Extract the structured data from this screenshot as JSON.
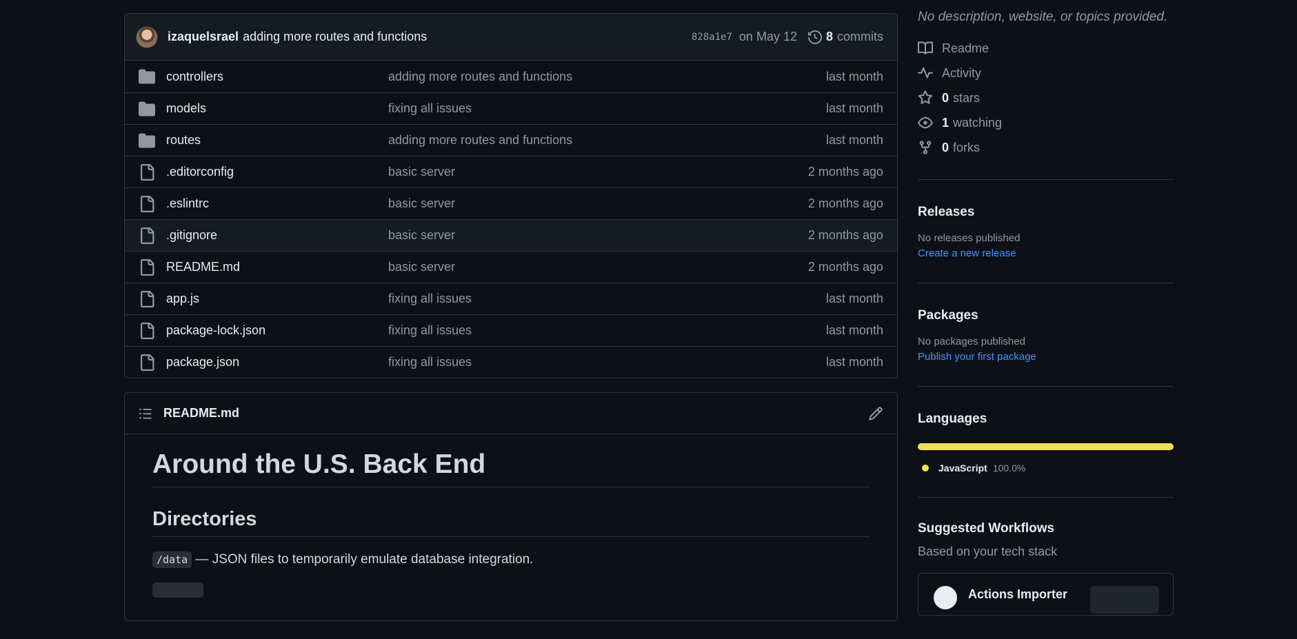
{
  "commit": {
    "author": "izaquelsrael",
    "message": "adding more routes and functions",
    "sha": "828a1e7",
    "date": "on May 12",
    "commit_count": "8",
    "commit_label": "commits"
  },
  "files": [
    {
      "name": "controllers",
      "type": "dir",
      "message": "adding more routes and functions",
      "age": "last month"
    },
    {
      "name": "models",
      "type": "dir",
      "message": "fixing all issues",
      "age": "last month"
    },
    {
      "name": "routes",
      "type": "dir",
      "message": "adding more routes and functions",
      "age": "last month"
    },
    {
      "name": ".editorconfig",
      "type": "file",
      "message": "basic server",
      "age": "2 months ago"
    },
    {
      "name": ".eslintrc",
      "type": "file",
      "message": "basic server",
      "age": "2 months ago"
    },
    {
      "name": ".gitignore",
      "type": "file",
      "message": "basic server",
      "age": "2 months ago"
    },
    {
      "name": "README.md",
      "type": "file",
      "message": "basic server",
      "age": "2 months ago"
    },
    {
      "name": "app.js",
      "type": "file",
      "message": "fixing all issues",
      "age": "last month"
    },
    {
      "name": "package-lock.json",
      "type": "file",
      "message": "fixing all issues",
      "age": "last month"
    },
    {
      "name": "package.json",
      "type": "file",
      "message": "fixing all issues",
      "age": "last month"
    }
  ],
  "readme": {
    "filename": "README.md",
    "h1": "Around the U.S. Back End",
    "h2": "Directories",
    "p1_code": "/data",
    "p1_text": " — JSON files to temporarily emulate database integration."
  },
  "about": {
    "description": "No description, website, or topics provided.",
    "readme": "Readme",
    "activity": "Activity",
    "stars_count": "0",
    "stars_label": "stars",
    "watching_count": "1",
    "watching_label": "watching",
    "forks_count": "0",
    "forks_label": "forks"
  },
  "releases": {
    "title": "Releases",
    "none": "No releases published",
    "link": "Create a new release"
  },
  "packages": {
    "title": "Packages",
    "none": "No packages published",
    "link": "Publish your first package"
  },
  "languages": {
    "title": "Languages",
    "items": [
      {
        "name": "JavaScript",
        "percent": "100.0%",
        "color": "#f1e05a"
      }
    ]
  },
  "workflows": {
    "title": "Suggested Workflows",
    "subtitle": "Based on your tech stack",
    "card_name": "Actions Importer"
  },
  "colors": {
    "background": "#0d1117",
    "border": "#30363d",
    "link": "#4493f8",
    "muted": "#9198a1",
    "folder": "#9198a1",
    "javascript": "#f1e05a"
  }
}
